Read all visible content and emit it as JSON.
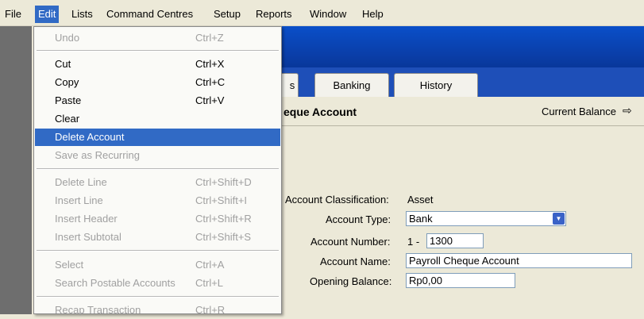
{
  "menubar": [
    "File",
    "Edit",
    "Lists",
    "Command Centres",
    "Setup",
    "Reports",
    "Window",
    "Help"
  ],
  "menu": {
    "undo": {
      "label": "Undo",
      "shortcut": "Ctrl+Z"
    },
    "cut": {
      "label": "Cut",
      "shortcut": "Ctrl+X"
    },
    "copy": {
      "label": "Copy",
      "shortcut": "Ctrl+C"
    },
    "paste": {
      "label": "Paste",
      "shortcut": "Ctrl+V"
    },
    "clear": {
      "label": "Clear"
    },
    "delete_account": {
      "label": "Delete Account"
    },
    "save_recurring": {
      "label": "Save as Recurring"
    },
    "delete_line": {
      "label": "Delete Line",
      "shortcut": "Ctrl+Shift+D"
    },
    "insert_line": {
      "label": "Insert Line",
      "shortcut": "Ctrl+Shift+I"
    },
    "insert_header": {
      "label": "Insert Header",
      "shortcut": "Ctrl+Shift+R"
    },
    "insert_subtotal": {
      "label": "Insert Subtotal",
      "shortcut": "Ctrl+Shift+S"
    },
    "select": {
      "label": "Select",
      "shortcut": "Ctrl+A"
    },
    "search": {
      "label": "Search Postable Accounts",
      "shortcut": "Ctrl+L"
    },
    "recap": {
      "label": "Recap Transaction",
      "shortcut": "Ctrl+R"
    }
  },
  "tabs": {
    "partial": "s",
    "banking": "Banking",
    "history": "History"
  },
  "account": {
    "title_fragment": "eque Account",
    "current_balance_label": "Current Balance",
    "classification_label": "Account Classification:",
    "classification_value": "Asset",
    "type_label": "Account Type:",
    "type_value": "Bank",
    "number_label": "Account Number:",
    "number_prefix": "1 -",
    "number_value": "1300",
    "name_label": "Account Name:",
    "name_value": "Payroll Cheque Account",
    "opening_label": "Opening Balance:",
    "opening_value": "Rp0,00"
  },
  "colors": {
    "highlight": "#316ac5",
    "titlebar": "#0a4fc9",
    "disabled": "#a0a0a0"
  }
}
